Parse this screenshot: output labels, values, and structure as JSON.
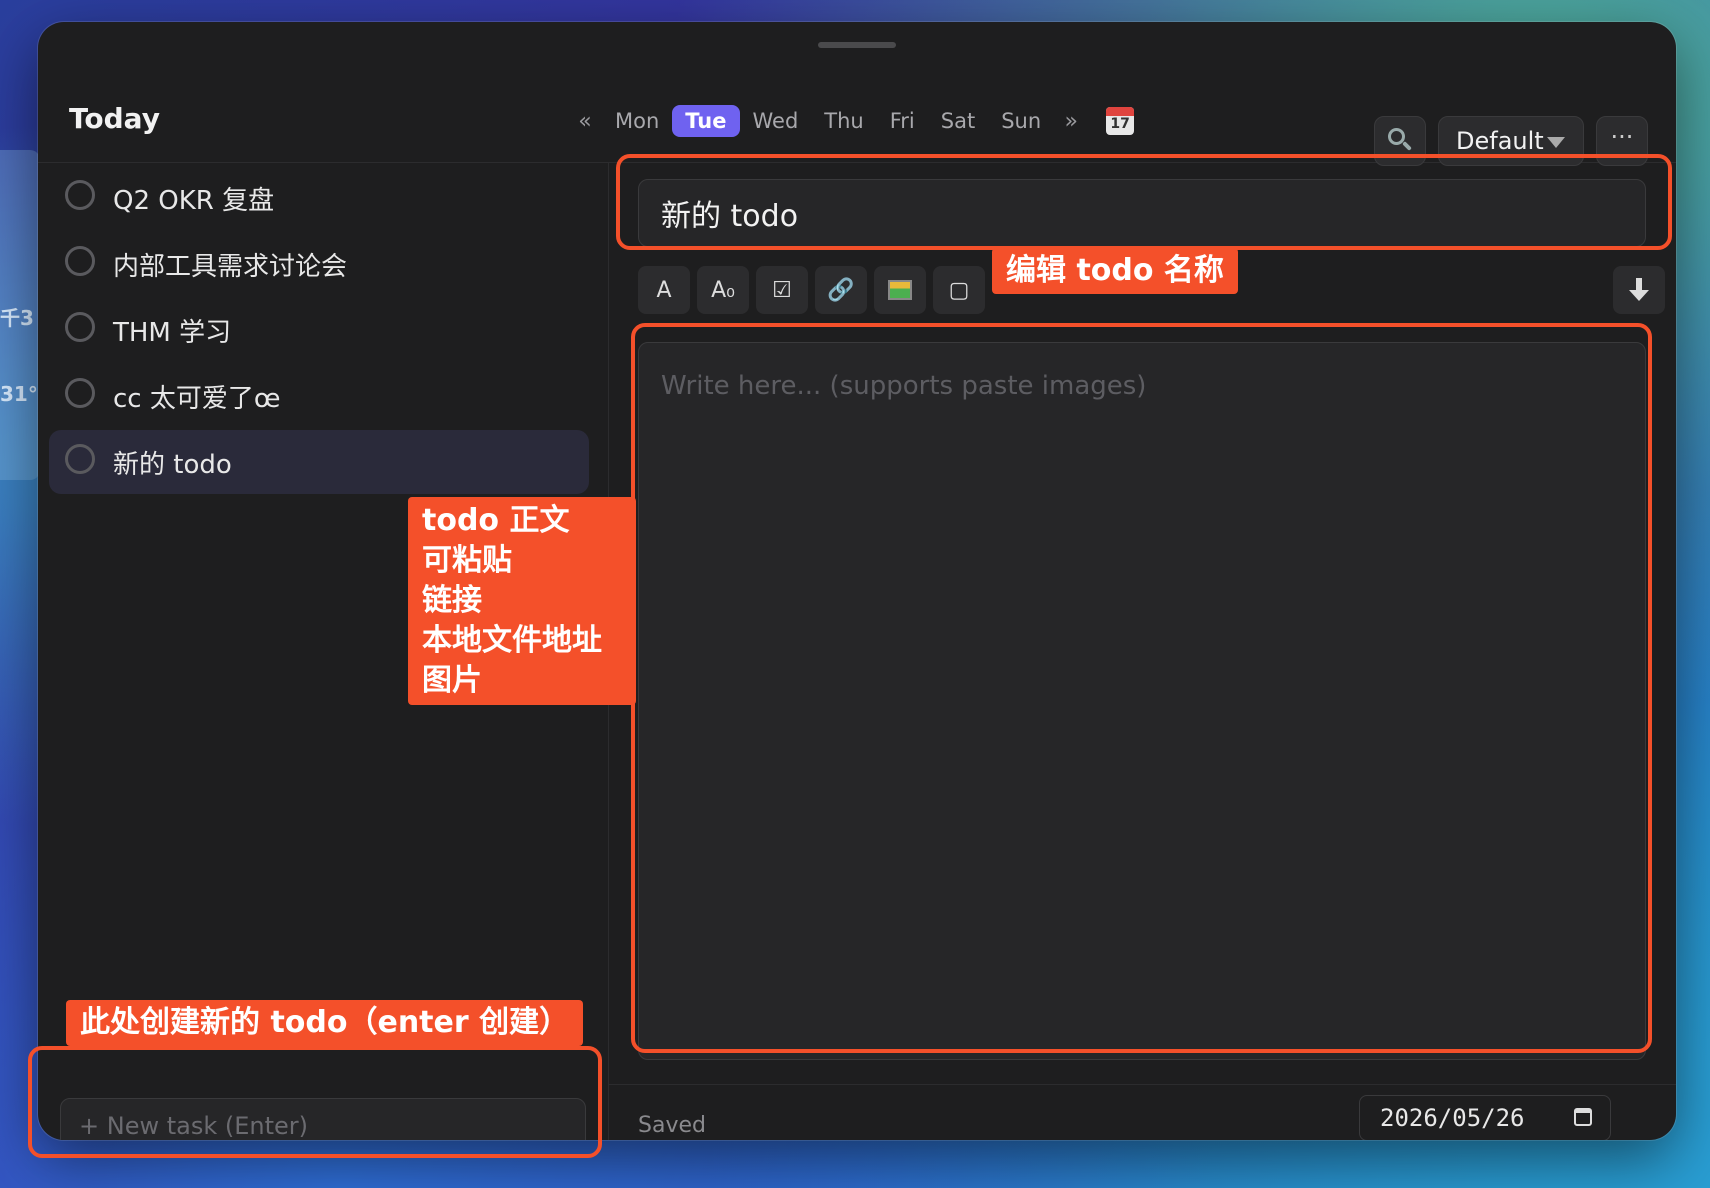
{
  "desktop_widget": {
    "top_text": "千3",
    "temp": "31°"
  },
  "header": {
    "title": "Today",
    "prev_week": "«",
    "next_week": "»",
    "days": [
      "Mon",
      "Tue",
      "Wed",
      "Thu",
      "Fri",
      "Sat",
      "Sun"
    ],
    "active_day": "Tue",
    "calendar_day": "17",
    "profile": "Default",
    "more": "···"
  },
  "tasks": [
    {
      "label": "Q2 OKR 复盘"
    },
    {
      "label": "内部工具需求讨论会"
    },
    {
      "label": "THM 学习"
    },
    {
      "label": "cc 太可爱了œ"
    },
    {
      "label": "新的 todo",
      "selected": true
    }
  ],
  "new_task": {
    "placeholder": "+ New task (Enter)"
  },
  "editor": {
    "title_value": "新的 todo",
    "toolbar": [
      "A",
      "A₀",
      "☑",
      "🔗",
      "image",
      "▢"
    ],
    "body_placeholder": "Write here... (supports paste images)",
    "status": "Saved",
    "date": "2026/05/26"
  },
  "annotations": {
    "title_label": "编辑 todo 名称",
    "body_label_lines": [
      "todo 正文",
      "可粘贴",
      "链接",
      "本地文件地址",
      "图片"
    ],
    "new_task_label": "此处创建新的 todo（enter 创建）"
  },
  "colors": {
    "accent": "#6f62f0",
    "annotation": "#f4502a",
    "window_bg": "#1e1e1f"
  }
}
